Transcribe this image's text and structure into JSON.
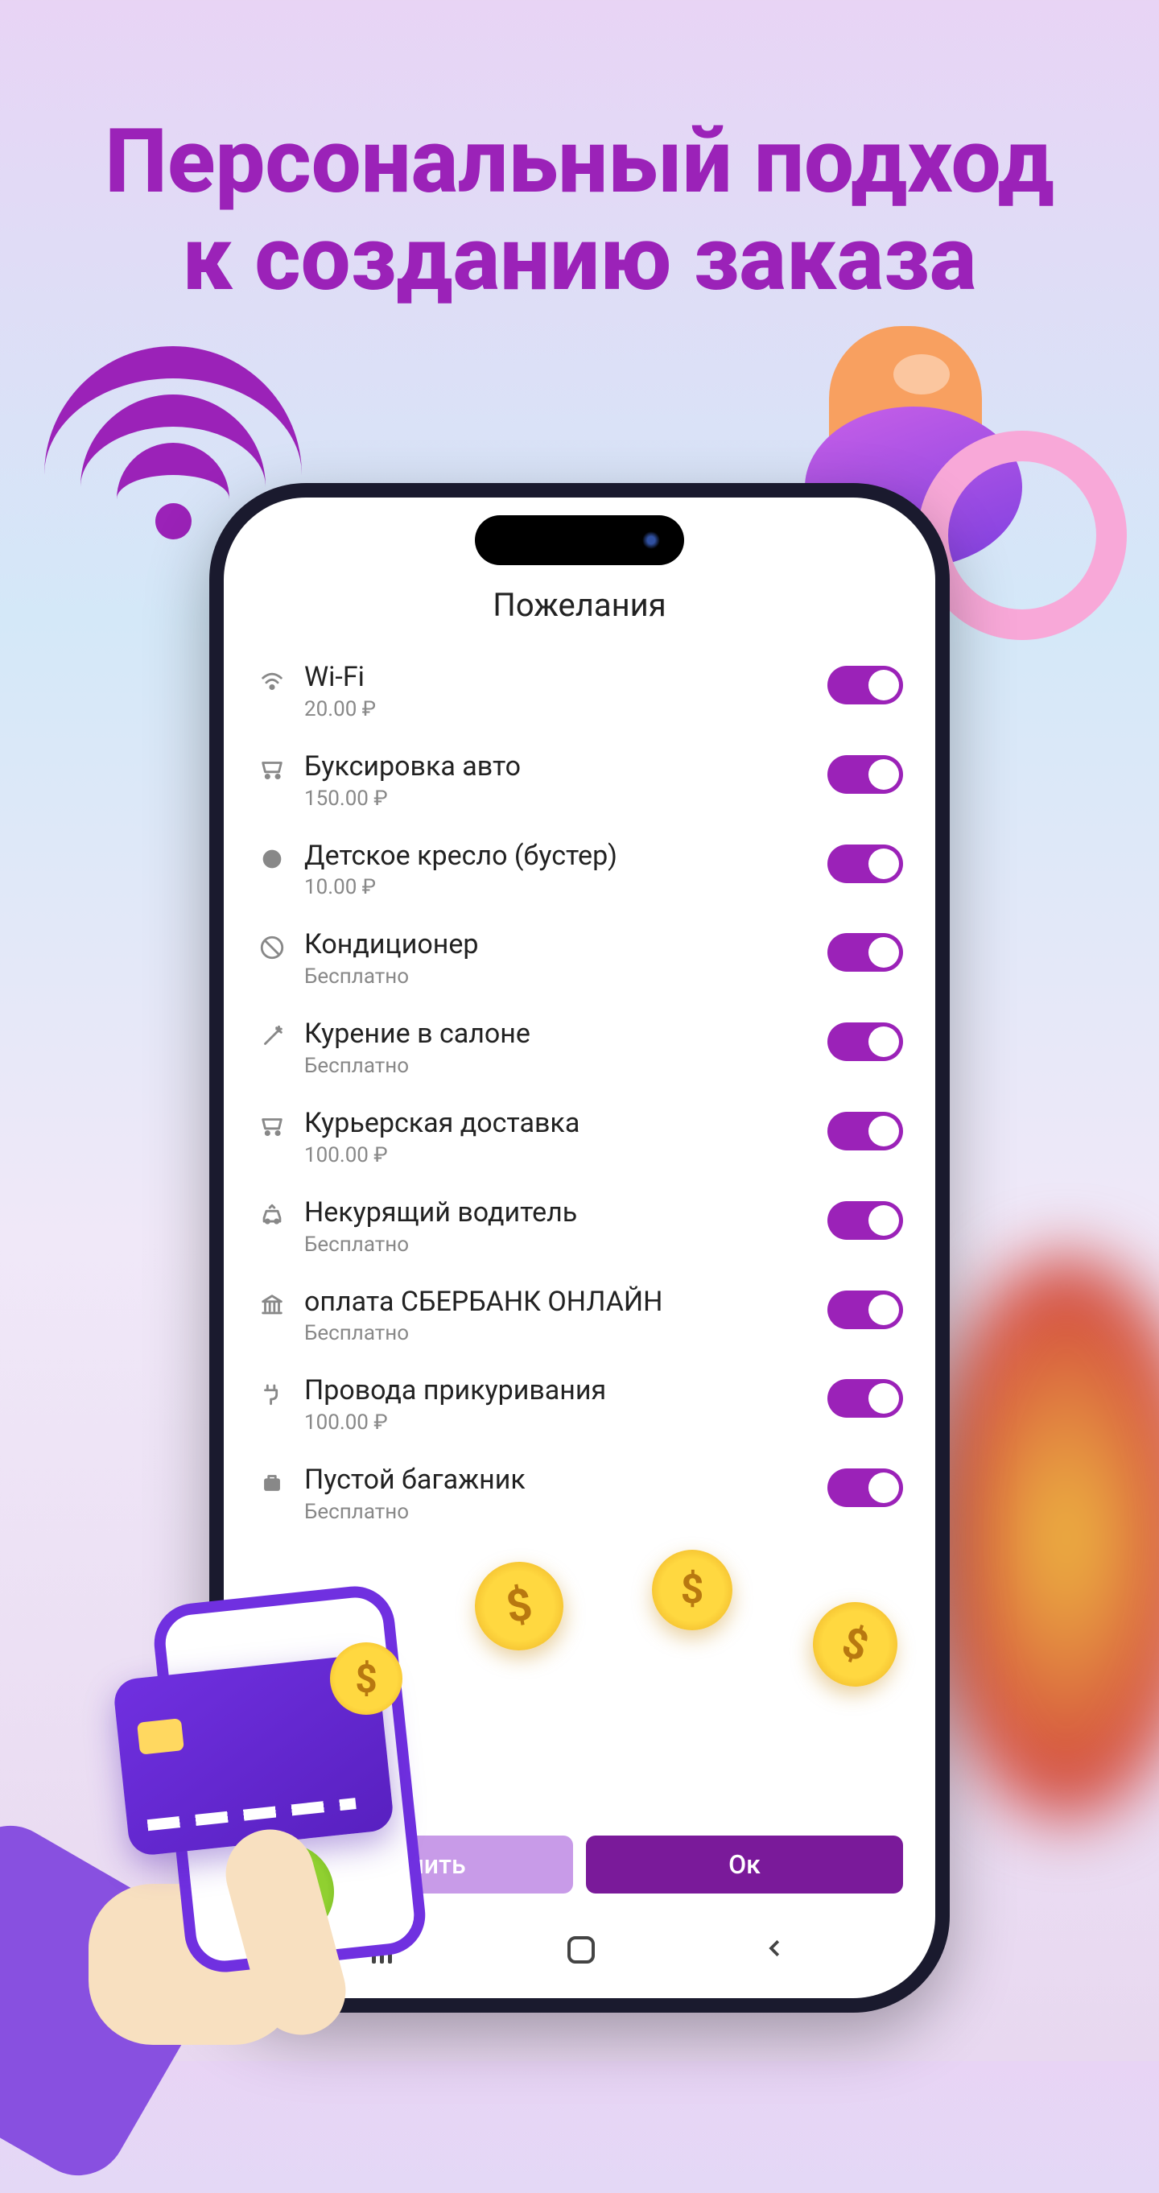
{
  "hero": {
    "line1": "Персональный подход",
    "line2": "к созданию заказа"
  },
  "screen": {
    "title": "Пожелания",
    "options": [
      {
        "icon": "wifi",
        "label": "Wi-Fi",
        "price": "20.00 ₽"
      },
      {
        "icon": "cart",
        "label": "Буксировка авто",
        "price": "150.00 ₽"
      },
      {
        "icon": "circle",
        "label": "Детское кресло (бустер)",
        "price": "10.00 ₽"
      },
      {
        "icon": "ban",
        "label": "Кондиционер",
        "price": "Бесплатно"
      },
      {
        "icon": "wand",
        "label": "Курение в салоне",
        "price": "Бесплатно"
      },
      {
        "icon": "cart",
        "label": "Курьерская доставка",
        "price": "100.00 ₽"
      },
      {
        "icon": "car",
        "label": "Некурящий водитель",
        "price": "Бесплатно"
      },
      {
        "icon": "bank",
        "label": "оплата СБЕРБАНК ОНЛАЙН",
        "price": "Бесплатно"
      },
      {
        "icon": "plug",
        "label": "Провода прикуривания",
        "price": "100.00 ₽"
      },
      {
        "icon": "bag",
        "label": "Пустой багажник",
        "price": "Бесплатно"
      }
    ],
    "buttons": {
      "cancel": "тменить",
      "ok": "Ок"
    }
  }
}
